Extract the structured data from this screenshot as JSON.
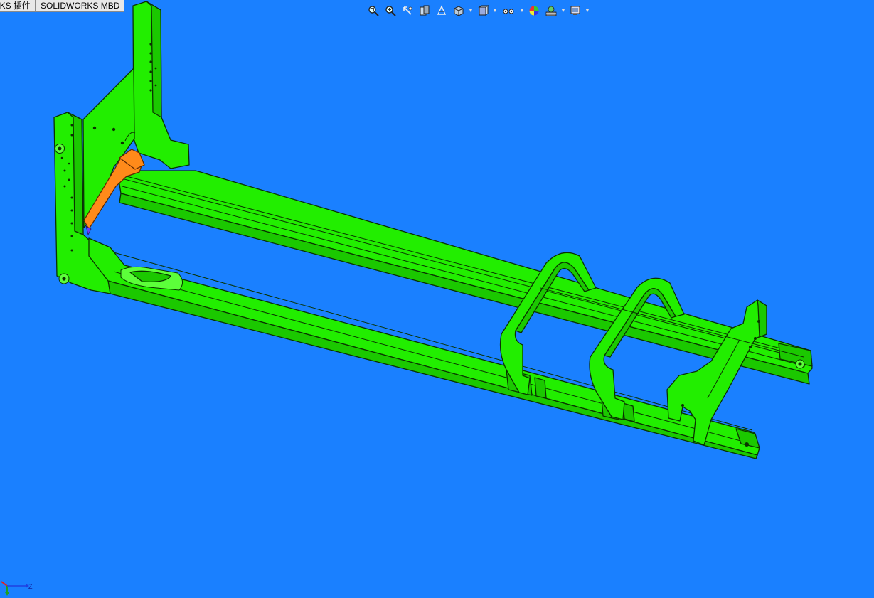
{
  "tabs": [
    {
      "label": "RKS 插件"
    },
    {
      "label": "SOLIDWORKS MBD"
    }
  ],
  "view_toolbar": {
    "buttons": [
      {
        "icon": "zoom-to-fit-icon",
        "has_dropdown": false
      },
      {
        "icon": "zoom-to-area-icon",
        "has_dropdown": false
      },
      {
        "icon": "previous-view-icon",
        "has_dropdown": false
      },
      {
        "icon": "section-view-icon",
        "has_dropdown": false
      },
      {
        "icon": "dynamic-annotation-views-icon",
        "has_dropdown": false
      },
      {
        "icon": "view-orientation-icon",
        "has_dropdown": true
      },
      {
        "icon": "display-style-icon",
        "has_dropdown": true
      },
      {
        "icon": "hide-show-items-icon",
        "has_dropdown": true
      },
      {
        "icon": "edit-appearance-icon",
        "has_dropdown": false
      },
      {
        "icon": "apply-scene-icon",
        "has_dropdown": true
      },
      {
        "icon": "view-settings-icon",
        "has_dropdown": true
      }
    ]
  },
  "graphics_area": {
    "background_color": "#1a80ff",
    "part_color": "#22ee00",
    "highlight_color": "#ff8a1a",
    "edge_color": "#0a3300"
  },
  "triad": {
    "x_axis_color": "#e02020",
    "y_axis_color": "#20a020",
    "z_axis_color": "#2040e0",
    "z_label": "Z"
  }
}
